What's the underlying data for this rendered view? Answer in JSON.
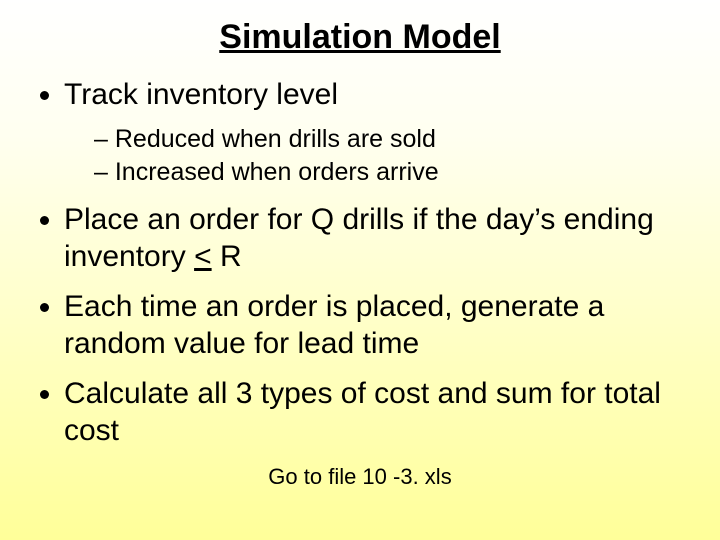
{
  "title": "Simulation Model",
  "bullets": {
    "b1": "Track inventory level",
    "b1_sub1": "Reduced when drills are sold",
    "b1_sub2": "Increased when orders arrive",
    "b2_pre": "Place an order for Q drills if the day’s ending inventory ",
    "b2_le": "<",
    "b2_post": " R",
    "b3": "Each time an order is placed, generate a random value for lead time",
    "b4": "Calculate all 3 types of cost and sum for total cost"
  },
  "footer": "Go to file 10 -3. xls"
}
